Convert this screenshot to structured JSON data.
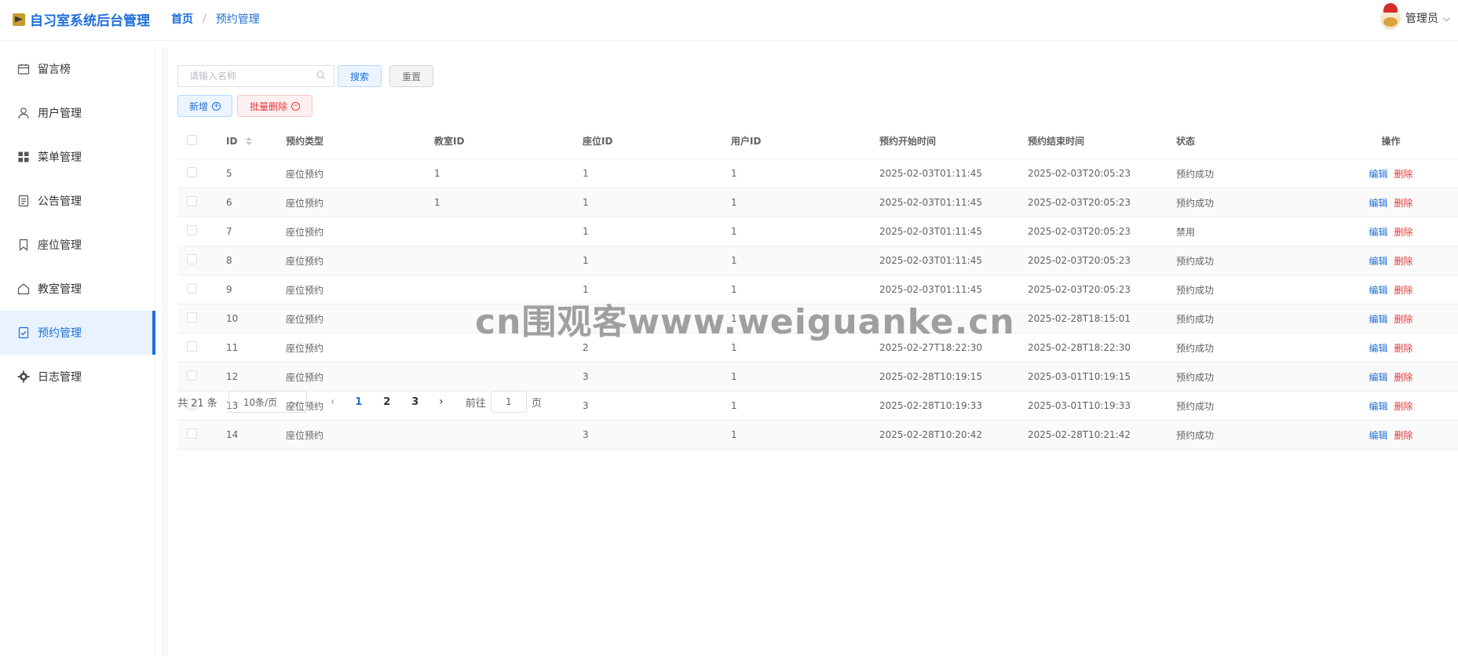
{
  "header": {
    "logo_text": "自习室系统后台管理",
    "breadcrumb": {
      "home": "首页",
      "separator": "/",
      "current": "预约管理"
    },
    "user": {
      "name": "管理员"
    }
  },
  "sidebar": {
    "items": [
      {
        "label": "留言榜",
        "icon": "calendar-icon",
        "active": false
      },
      {
        "label": "用户管理",
        "icon": "user-icon",
        "active": false
      },
      {
        "label": "菜单管理",
        "icon": "grid-icon",
        "active": false
      },
      {
        "label": "公告管理",
        "icon": "document-icon",
        "active": false
      },
      {
        "label": "座位管理",
        "icon": "bookmark-icon",
        "active": false
      },
      {
        "label": "教室管理",
        "icon": "home-icon",
        "active": false
      },
      {
        "label": "预约管理",
        "icon": "checklist-icon",
        "active": true
      },
      {
        "label": "日志管理",
        "icon": "gear-icon",
        "active": false
      }
    ]
  },
  "toolbar": {
    "search_placeholder": "请输入名称",
    "search_label": "搜索",
    "reset_label": "重置",
    "add_label": "新增",
    "batch_delete_label": "批量删除"
  },
  "table": {
    "columns": [
      "ID",
      "预约类型",
      "教室ID",
      "座位ID",
      "用户ID",
      "预约开始时间",
      "预约结束时间",
      "状态",
      "操作"
    ],
    "edit_label": "编辑",
    "delete_label": "删除",
    "rows": [
      {
        "id": "5",
        "type": "座位预约",
        "room": "1",
        "seat": "1",
        "user": "1",
        "start": "2025-02-03T01:11:45",
        "end": "2025-02-03T20:05:23",
        "status": "预约成功"
      },
      {
        "id": "6",
        "type": "座位预约",
        "room": "1",
        "seat": "1",
        "user": "1",
        "start": "2025-02-03T01:11:45",
        "end": "2025-02-03T20:05:23",
        "status": "预约成功"
      },
      {
        "id": "7",
        "type": "座位预约",
        "room": "",
        "seat": "1",
        "user": "1",
        "start": "2025-02-03T01:11:45",
        "end": "2025-02-03T20:05:23",
        "status": "禁用"
      },
      {
        "id": "8",
        "type": "座位预约",
        "room": "",
        "seat": "1",
        "user": "1",
        "start": "2025-02-03T01:11:45",
        "end": "2025-02-03T20:05:23",
        "status": "预约成功"
      },
      {
        "id": "9",
        "type": "座位预约",
        "room": "",
        "seat": "1",
        "user": "1",
        "start": "2025-02-03T01:11:45",
        "end": "2025-02-03T20:05:23",
        "status": "预约成功"
      },
      {
        "id": "10",
        "type": "座位预约",
        "room": "",
        "seat": "",
        "user": "1",
        "start": "",
        "end": "2025-02-28T18:15:01",
        "status": "预约成功"
      },
      {
        "id": "11",
        "type": "座位预约",
        "room": "",
        "seat": "2",
        "user": "1",
        "start": "2025-02-27T18:22:30",
        "end": "2025-02-28T18:22:30",
        "status": "预约成功"
      },
      {
        "id": "12",
        "type": "座位预约",
        "room": "",
        "seat": "3",
        "user": "1",
        "start": "2025-02-28T10:19:15",
        "end": "2025-03-01T10:19:15",
        "status": "预约成功"
      },
      {
        "id": "13",
        "type": "座位预约",
        "room": "",
        "seat": "3",
        "user": "1",
        "start": "2025-02-28T10:19:33",
        "end": "2025-03-01T10:19:33",
        "status": "预约成功"
      },
      {
        "id": "14",
        "type": "座位预约",
        "room": "",
        "seat": "3",
        "user": "1",
        "start": "2025-02-28T10:20:42",
        "end": "2025-02-28T10:21:42",
        "status": "预约成功"
      }
    ]
  },
  "pagination": {
    "total_text": "共 21 条",
    "page_size": "10条/页",
    "pages": [
      "1",
      "2",
      "3"
    ],
    "current_page": "1",
    "goto_prefix": "前往",
    "goto_value": "1",
    "goto_suffix": "页"
  },
  "watermark": "cn围观客www.weiguanke.cn"
}
